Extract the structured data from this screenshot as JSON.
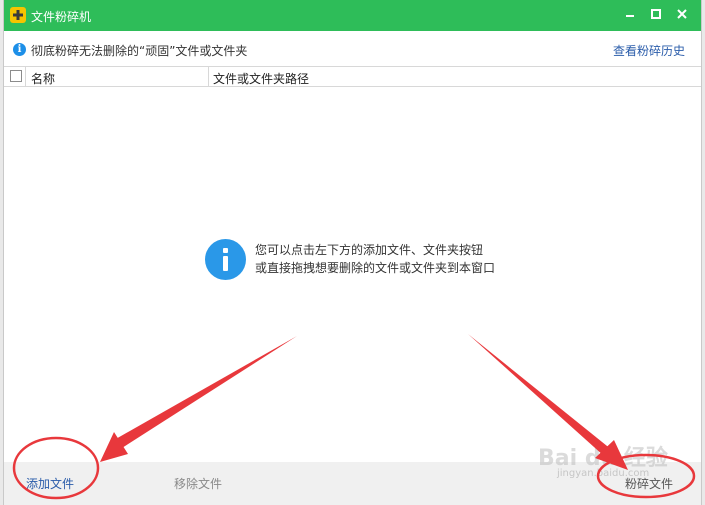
{
  "window": {
    "title": "文件粉碎机"
  },
  "infobar": {
    "description": "彻底粉碎无法删除的“顽固”文件或文件夹",
    "history_link": "查看粉碎历史"
  },
  "table": {
    "columns": [
      "名称",
      "文件或文件夹路径"
    ]
  },
  "empty_hint": {
    "line1": "您可以点击左下方的添加文件、文件夹按钮",
    "line2": "或直接拖拽想要删除的文件或文件夹到本窗口"
  },
  "bottombar": {
    "add_label": "添加文件",
    "remove_label": "移除文件",
    "shred_label": "粉碎文件"
  },
  "watermark": {
    "main": "Bai du 经验",
    "sub": "jingyan.baidu.com"
  },
  "colors": {
    "titlebar": "#2ebd59",
    "info_blue": "#2a98e8",
    "annotation_red": "#e8383c",
    "link_blue": "#2a5caa"
  },
  "icons": {
    "app": "shredder-app-icon",
    "info": "info-icon",
    "minimize": "minimize-icon",
    "maximize": "maximize-icon",
    "close": "close-icon"
  }
}
